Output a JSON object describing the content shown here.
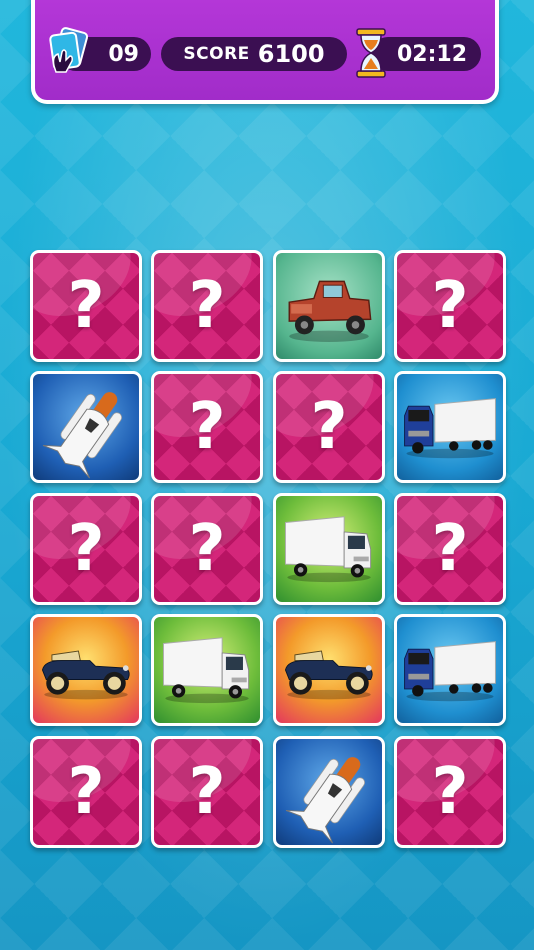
{
  "hud": {
    "moves": "09",
    "score_label": "SCORE",
    "score": "6100",
    "time": "02:12"
  },
  "cards": [
    {
      "state": "hidden",
      "label": "?"
    },
    {
      "state": "hidden",
      "label": "?"
    },
    {
      "state": "revealed",
      "image": "pickup-truck-icon"
    },
    {
      "state": "hidden",
      "label": "?"
    },
    {
      "state": "revealed",
      "image": "space-shuttle-icon"
    },
    {
      "state": "hidden",
      "label": "?"
    },
    {
      "state": "hidden",
      "label": "?"
    },
    {
      "state": "revealed",
      "image": "semi-truck-icon"
    },
    {
      "state": "hidden",
      "label": "?"
    },
    {
      "state": "hidden",
      "label": "?"
    },
    {
      "state": "revealed",
      "image": "box-truck-icon"
    },
    {
      "state": "hidden",
      "label": "?"
    },
    {
      "state": "revealed",
      "image": "vintage-car-icon"
    },
    {
      "state": "revealed",
      "image": "box-truck-icon"
    },
    {
      "state": "revealed",
      "image": "vintage-car-icon"
    },
    {
      "state": "revealed",
      "image": "semi-truck-icon"
    },
    {
      "state": "hidden",
      "label": "?"
    },
    {
      "state": "hidden",
      "label": "?"
    },
    {
      "state": "revealed",
      "image": "space-shuttle-icon"
    },
    {
      "state": "hidden",
      "label": "?"
    }
  ],
  "colors": {
    "hud_background": "#a12cc9",
    "pill": "#3b0f52",
    "card_back": "#d4267a",
    "background": "#1ea8d3"
  }
}
